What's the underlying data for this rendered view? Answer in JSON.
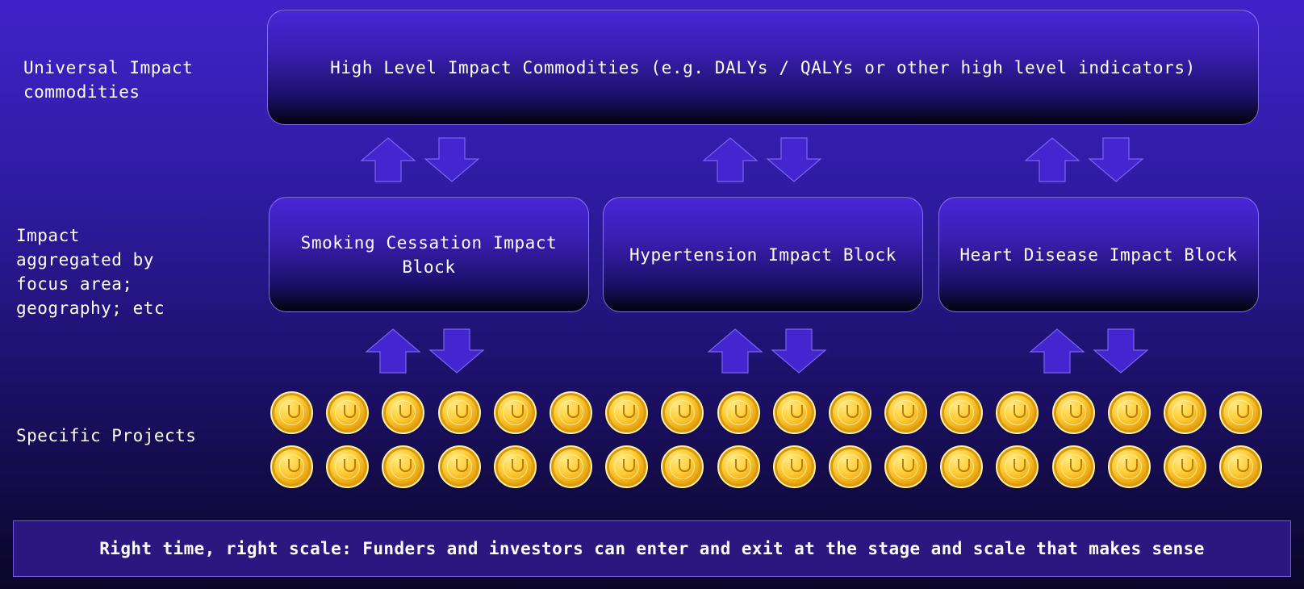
{
  "labels": {
    "universal": "Universal Impact\ncommodities",
    "aggregated": "Impact\naggregated by\nfocus area;\ngeography; etc",
    "projects": "Specific Projects"
  },
  "top_box": {
    "text": "High Level Impact Commodities (e.g. DALYs / QALYs or other high level indicators)"
  },
  "impact_blocks": [
    {
      "text": "Smoking Cessation Impact Block"
    },
    {
      "text": "Hypertension Impact Block"
    },
    {
      "text": "Heart Disease Impact Block"
    }
  ],
  "coins": {
    "rows": 2,
    "per_row": 18,
    "icon": "coin-icon"
  },
  "footer": {
    "text": "Right time, right scale: Funders and investors can enter and exit at the stage and scale that makes sense"
  },
  "colors": {
    "arrow_fill": "#4326d0",
    "arrow_stroke": "#7a63f0",
    "coin_gold": "#ffcf3a"
  }
}
